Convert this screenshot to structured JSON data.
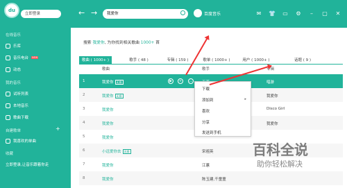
{
  "app": {
    "logo": "du",
    "login_label": "立即登录",
    "brand": "百度音乐"
  },
  "nav": {
    "back": "←",
    "forward": "→"
  },
  "search": {
    "value": "我爱你"
  },
  "topbar_icons": [
    "mail-icon",
    "shirt-icon",
    "message-icon",
    "settings-icon",
    "minimize-icon",
    "restore-icon",
    "close-icon"
  ],
  "sidebar": {
    "online_head": "在线音乐",
    "online_items": [
      "乐库",
      "音乐电台",
      "动态"
    ],
    "radio_badge": "NEW",
    "my_head": "我的音乐",
    "my_items": [
      "试听列表",
      "本地音乐",
      "歌曲下载"
    ],
    "playlist_head": "自建歌单",
    "playlist_items": [
      "我喜欢的单曲"
    ],
    "fav_head": "收藏",
    "fav_items": [
      "立即登录,让音乐跟着你走"
    ]
  },
  "main": {
    "summary": {
      "prefix": "搜索",
      "keyword": "我爱你",
      "middle": ", 为你找到相关歌曲",
      "count": "1000+",
      "suffix": "首"
    },
    "tabs": [
      "歌曲 ( 1000+ )",
      "歌手 ( 48 )",
      "专辑 ( 159 )",
      "歌单 ( 1000+ )",
      "用户 ( 1000+ )",
      "话题 ( 9 )"
    ],
    "headers": {
      "song": "歌曲",
      "artist": "歌手",
      "album": "专辑"
    },
    "rows": [
      {
        "num": "1",
        "song": "我爱你",
        "tags": "无损",
        "artist": "王菲",
        "album": "唱游"
      },
      {
        "num": "2",
        "song": "我爱你",
        "tags": "无损",
        "artist": "",
        "album": "我爱你"
      },
      {
        "num": "3",
        "song": "我爱你",
        "tags": "",
        "artist": "",
        "album": "Disco Girl"
      },
      {
        "num": "4",
        "song": "我爱你",
        "tags": "",
        "artist": "",
        "album": "我爱你"
      },
      {
        "num": "5",
        "song": "我爱你",
        "tags": "",
        "artist": "",
        "album": ""
      },
      {
        "num": "6",
        "song": "小远爱你去",
        "tags": "无损",
        "artist": "宋祖英",
        "album": ""
      },
      {
        "num": "7",
        "song": "我爱你",
        "tags": "",
        "artist": "江蕙",
        "album": ""
      },
      {
        "num": "8",
        "song": "我爱你",
        "tags": "",
        "artist": "陈玉建,千童童",
        "album": ""
      }
    ],
    "row_icons": [
      "play-icon",
      "add-icon",
      "more-icon"
    ]
  },
  "context_menu": {
    "items": [
      "下载",
      "添加到",
      "喜欢",
      "分享",
      "发送到手机"
    ],
    "submenu_arrow": "▸"
  },
  "watermark": {
    "main": "百科全说",
    "sub": "助你轻松解决"
  },
  "colors": {
    "accent": "#21b39a",
    "arrow": "#e33333"
  }
}
